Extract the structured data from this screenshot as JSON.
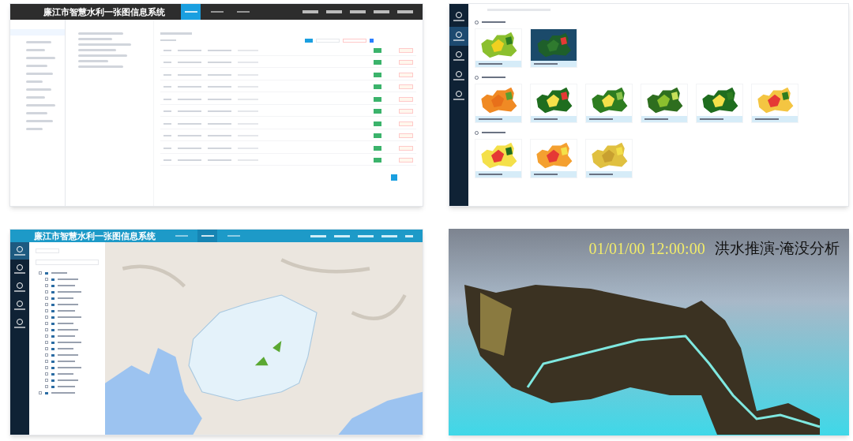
{
  "panels": [
    {
      "kind": "admin",
      "title": "廉江市智慧水利一张图信息系统",
      "nav_tabs": [
        {
          "selected": true
        },
        {
          "selected": false
        },
        {
          "selected": false
        }
      ]
    },
    {
      "kind": "gallery",
      "sidebar_items": [
        {
          "selected": false
        },
        {
          "selected": true
        },
        {
          "selected": false
        },
        {
          "selected": false
        },
        {
          "selected": false
        }
      ]
    },
    {
      "kind": "map",
      "title": "廉江市智慧水利一张图信息系统",
      "nav_tabs": [
        {
          "selected": false
        },
        {
          "selected": true
        },
        {
          "selected": false
        }
      ],
      "sidebar_items": [
        {
          "selected": true
        },
        {
          "selected": false
        },
        {
          "selected": false
        },
        {
          "selected": false
        },
        {
          "selected": false
        }
      ]
    },
    {
      "kind": "flood",
      "timestamp": "01/01/00 12:00:00",
      "caption": "洪水推演-淹没分析"
    }
  ]
}
